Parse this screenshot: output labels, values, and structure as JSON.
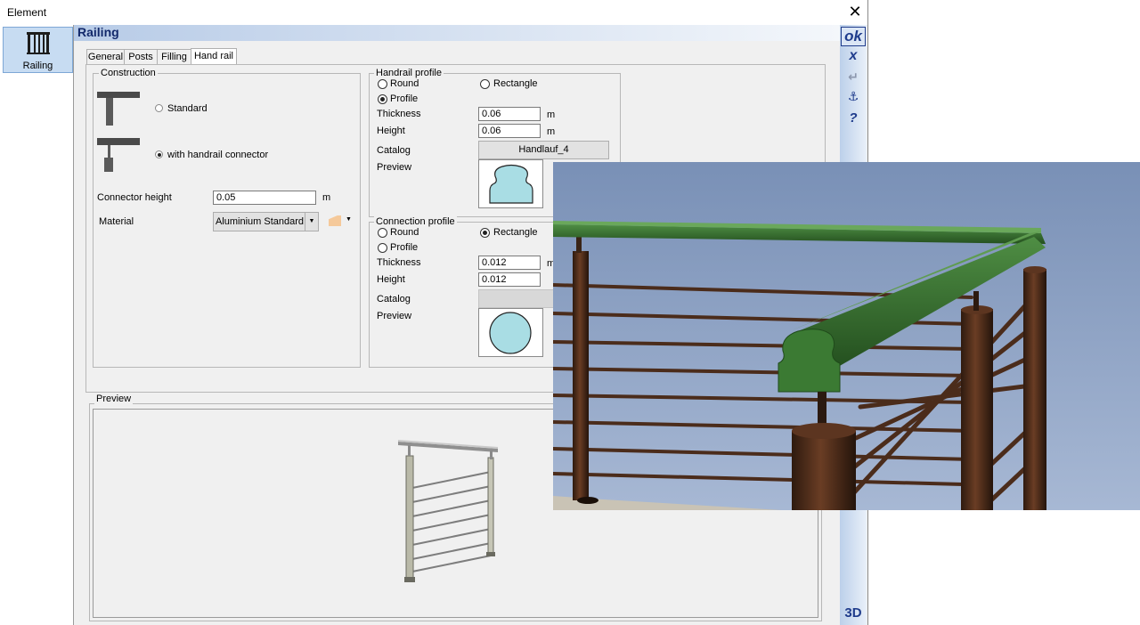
{
  "window": {
    "title": "Element",
    "close_glyph": "✕"
  },
  "nav": {
    "items": [
      {
        "label": "Railing",
        "icon": "railing-icon",
        "selected": true
      }
    ]
  },
  "header": {
    "title": "Railing"
  },
  "side_buttons": {
    "ok": "ok",
    "cancel": "x",
    "enter": "↵",
    "anchor": "⚓",
    "help": "?",
    "view3d": "3D"
  },
  "tabs": [
    {
      "label": "General",
      "active": false
    },
    {
      "label": "Posts",
      "active": false
    },
    {
      "label": "Filling",
      "active": false
    },
    {
      "label": "Hand rail",
      "active": true
    }
  ],
  "construction": {
    "group_label": "Construction",
    "options": [
      {
        "label": "Standard",
        "selected": false
      },
      {
        "label": "with handrail connector",
        "selected": true
      }
    ],
    "connector_height_label": "Connector height",
    "connector_height_value": "0.05",
    "connector_height_unit": "m",
    "material_label": "Material",
    "material_value": "Aluminium Standard",
    "material_swatch_color": "#f5c99a"
  },
  "handrail_profile": {
    "group_label": "Handrail profile",
    "round_label": "Round",
    "round_selected": false,
    "rectangle_label": "Rectangle",
    "rectangle_selected": false,
    "profile_label": "Profile",
    "profile_selected": true,
    "thickness_label": "Thickness",
    "thickness_value": "0.06",
    "thickness_unit": "m",
    "height_label": "Height",
    "height_value": "0.06",
    "height_unit": "m",
    "catalog_label": "Catalog",
    "catalog_value": "Handlauf_4",
    "preview_label": "Preview"
  },
  "connection_profile": {
    "group_label": "Connection profile",
    "round_label": "Round",
    "round_selected": false,
    "rectangle_label": "Rectangle",
    "rectangle_selected": true,
    "profile_label": "Profile",
    "profile_selected": false,
    "thickness_label": "Thickness",
    "thickness_value": "0.012",
    "thickness_unit": "m",
    "height_label": "Height",
    "height_value": "0.012",
    "catalog_label": "Catalog",
    "catalog_value": "",
    "preview_label": "Preview"
  },
  "preview_section": {
    "label": "Preview"
  },
  "colors": {
    "header_text": "#12296b",
    "profile_fill": "#a9dde4",
    "rail_green": "#2f6b2a",
    "post_brown": "#4a2a1a",
    "sky": "#8fa5c6"
  }
}
